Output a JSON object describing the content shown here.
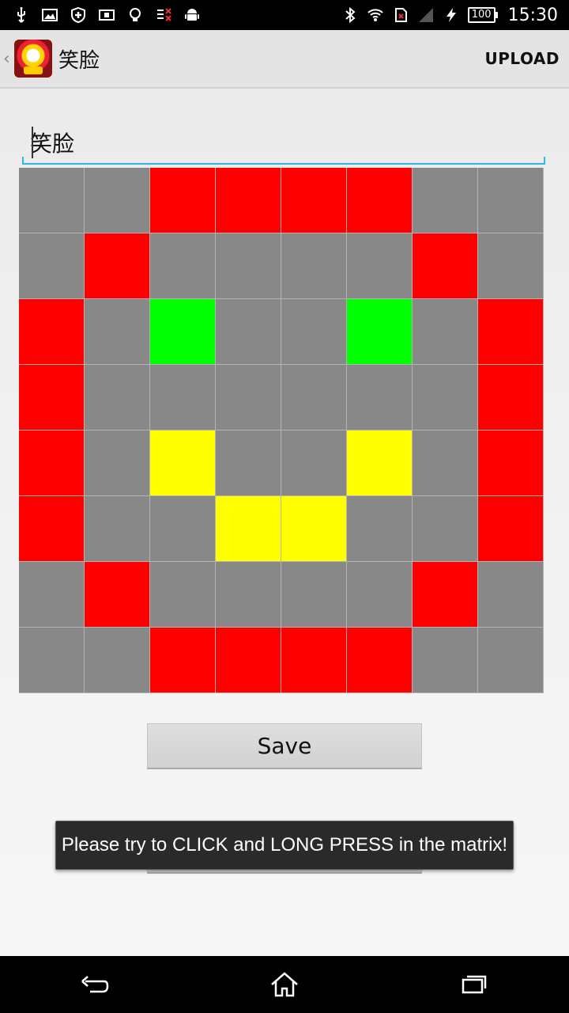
{
  "status_bar": {
    "time": "15:30",
    "battery_level": "100",
    "icons_left": [
      "usb-icon",
      "image-icon",
      "shield-icon",
      "info-card-icon",
      "bulb-icon",
      "sim-error-icon",
      "android-icon"
    ],
    "icons_right": [
      "bluetooth-icon",
      "wifi-icon",
      "sim-icon",
      "signal-icon",
      "charging-icon"
    ]
  },
  "action_bar": {
    "title": "笑脸",
    "upload_label": "UPLOAD"
  },
  "name_field": {
    "value": "笑脸"
  },
  "matrix": {
    "colors": {
      "G": "#888888",
      "R": "#ff0000",
      "N": "#00ff00",
      "Y": "#ffff00"
    },
    "rows": [
      [
        "G",
        "G",
        "R",
        "R",
        "R",
        "R",
        "G",
        "G"
      ],
      [
        "G",
        "R",
        "G",
        "G",
        "G",
        "G",
        "R",
        "G"
      ],
      [
        "R",
        "G",
        "N",
        "G",
        "G",
        "N",
        "G",
        "R"
      ],
      [
        "R",
        "G",
        "G",
        "G",
        "G",
        "G",
        "G",
        "R"
      ],
      [
        "R",
        "G",
        "Y",
        "G",
        "G",
        "Y",
        "G",
        "R"
      ],
      [
        "R",
        "G",
        "G",
        "Y",
        "Y",
        "G",
        "G",
        "R"
      ],
      [
        "G",
        "R",
        "G",
        "G",
        "G",
        "G",
        "R",
        "G"
      ],
      [
        "G",
        "G",
        "R",
        "R",
        "R",
        "R",
        "G",
        "G"
      ]
    ]
  },
  "buttons": {
    "save_label": "Save"
  },
  "toast": {
    "message": "Please try to CLICK and LONG PRESS in the matrix!"
  }
}
